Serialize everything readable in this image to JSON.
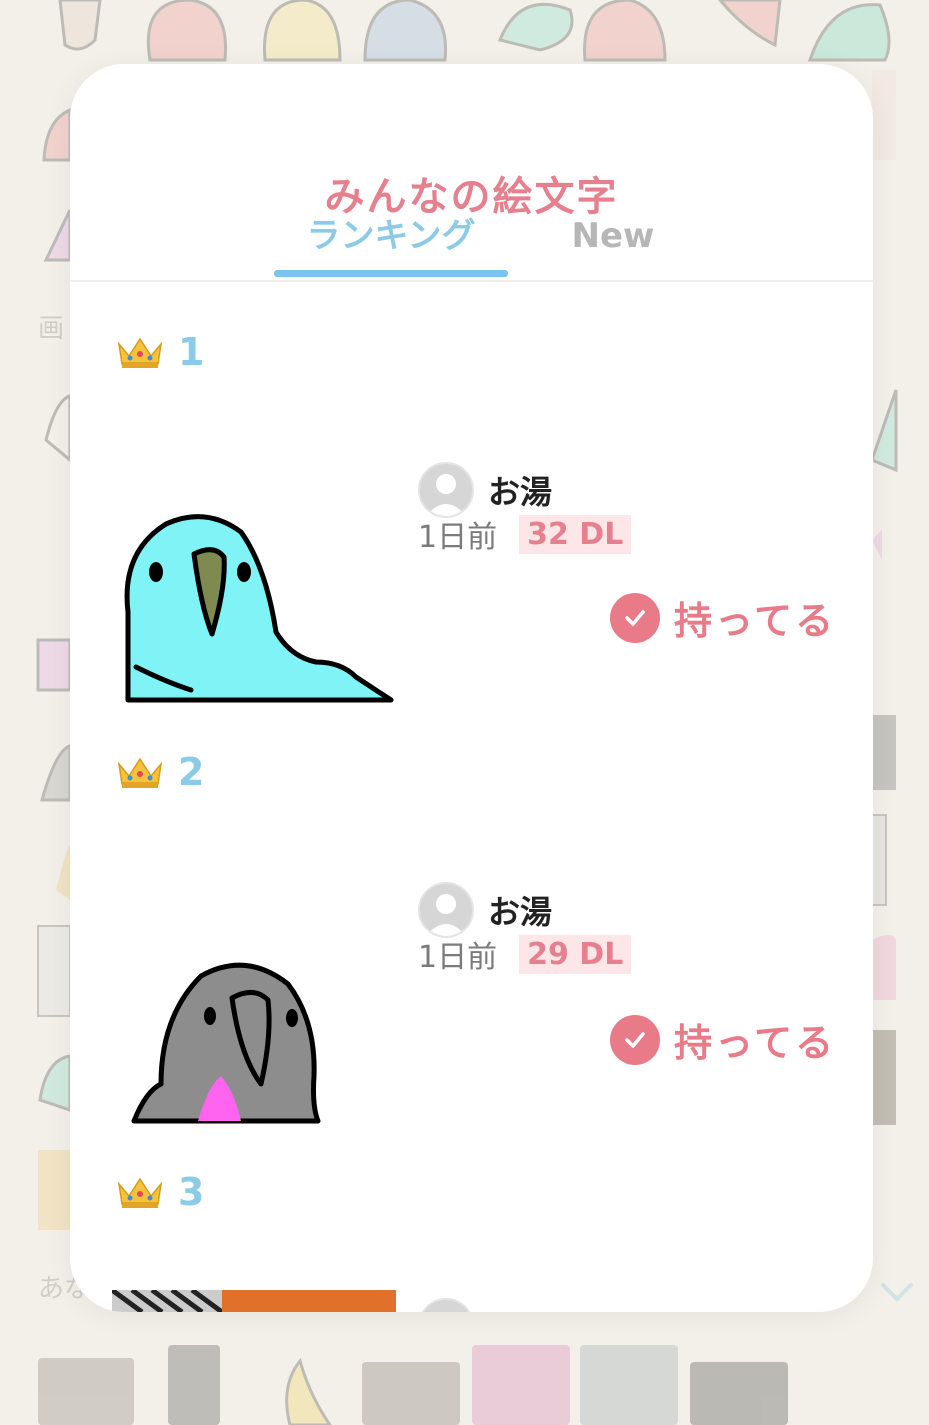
{
  "modal": {
    "title": "みんなの絵文字",
    "tabs": [
      {
        "label": "ランキング",
        "active": true
      },
      {
        "label": "New",
        "active": false
      }
    ]
  },
  "ranking": [
    {
      "rank": "1",
      "user": "お湯",
      "time": "1日前",
      "downloads": "32 DL",
      "status": "持ってる",
      "emoji": "cyan-parrot"
    },
    {
      "rank": "2",
      "user": "お湯",
      "time": "1日前",
      "downloads": "29 DL",
      "status": "持ってる",
      "emoji": "gray-parrot"
    },
    {
      "rank": "3",
      "emoji": "partial-thumbnail"
    }
  ],
  "background": {
    "text_1": "画",
    "text_2": "あな"
  },
  "colors": {
    "accent_pink": "#e6808f",
    "accent_blue": "#7cc5ea",
    "dl_badge_bg": "#fde6e8",
    "parrot_cyan": "#7ff3f5",
    "parrot_gray": "#8d8d8d"
  }
}
